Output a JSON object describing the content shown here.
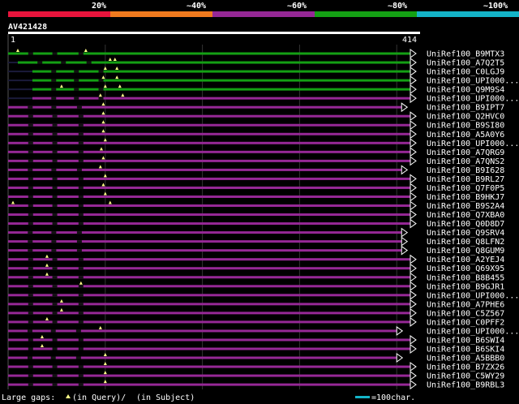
{
  "header": {
    "pct_labels": [
      "20%",
      "~40%",
      "~60%",
      "~80%",
      "~100%"
    ],
    "band_colors": [
      "#e8143c",
      "#f07a1e",
      "#962896",
      "#14a014",
      "#14b4c8"
    ]
  },
  "query": {
    "title": "AV421428",
    "start": "1",
    "end": "414",
    "length": 414
  },
  "colors": {
    "green": "#14a014",
    "purple": "#962896",
    "gap": "#222",
    "grid": "#333",
    "scale": "#14b4c8"
  },
  "hits": [
    {
      "name": "UniRef100_B9MTX3",
      "color": "green",
      "start": 0,
      "end": 414,
      "q_gaps": [
        10,
        80
      ]
    },
    {
      "name": "UniRef100_A7Q2T5",
      "color": "green",
      "start": 10,
      "end": 414,
      "q_gaps": [
        110,
        105
      ]
    },
    {
      "name": "UniRef100_C0LGJ9",
      "color": "green",
      "start": 25,
      "end": 414,
      "q_gaps": [
        100,
        112
      ]
    },
    {
      "name": "UniRef100_UPI000...",
      "color": "green",
      "start": 25,
      "end": 414,
      "q_gaps": [
        98,
        112
      ]
    },
    {
      "name": "UniRef100_Q9M9S4",
      "color": "green",
      "start": 25,
      "end": 414,
      "q_gaps": [
        55,
        100,
        115
      ]
    },
    {
      "name": "UniRef100_UPI000...",
      "color": "purple",
      "start": 25,
      "end": 414,
      "q_gaps": [
        95,
        118
      ]
    },
    {
      "name": "UniRef100_B9IPT7",
      "color": "purple",
      "start": 0,
      "end": 405,
      "q_gaps": [
        98
      ]
    },
    {
      "name": "UniRef100_Q2HVC0",
      "color": "purple",
      "start": 0,
      "end": 414,
      "q_gaps": [
        98
      ]
    },
    {
      "name": "UniRef100_B9SI80",
      "color": "purple",
      "start": 0,
      "end": 414,
      "q_gaps": [
        98
      ]
    },
    {
      "name": "UniRef100_A5A0Y6",
      "color": "purple",
      "start": 0,
      "end": 414,
      "q_gaps": [
        98
      ]
    },
    {
      "name": "UniRef100_UPI000...",
      "color": "purple",
      "start": 0,
      "end": 414,
      "q_gaps": [
        100
      ]
    },
    {
      "name": "UniRef100_A7QRG9",
      "color": "purple",
      "start": 0,
      "end": 414,
      "q_gaps": [
        96
      ]
    },
    {
      "name": "UniRef100_A7QNS2",
      "color": "purple",
      "start": 0,
      "end": 414,
      "q_gaps": [
        98
      ]
    },
    {
      "name": "UniRef100_B9I628",
      "color": "purple",
      "start": 0,
      "end": 405,
      "q_gaps": [
        95
      ]
    },
    {
      "name": "UniRef100_B9RL27",
      "color": "purple",
      "start": 0,
      "end": 414,
      "q_gaps": [
        100
      ]
    },
    {
      "name": "UniRef100_Q7F0P5",
      "color": "purple",
      "start": 0,
      "end": 414,
      "q_gaps": [
        98
      ]
    },
    {
      "name": "UniRef100_B9HKJ7",
      "color": "purple",
      "start": 0,
      "end": 414,
      "q_gaps": [
        100
      ]
    },
    {
      "name": "UniRef100_B9S2A4",
      "color": "purple",
      "start": 0,
      "end": 414,
      "q_gaps": [
        5,
        105
      ]
    },
    {
      "name": "UniRef100_Q7XBA0",
      "color": "purple",
      "start": 0,
      "end": 414,
      "q_gaps": []
    },
    {
      "name": "UniRef100_Q0D8D7",
      "color": "purple",
      "start": 0,
      "end": 414,
      "q_gaps": []
    },
    {
      "name": "UniRef100_Q9SRV4",
      "color": "purple",
      "start": 0,
      "end": 405,
      "q_gaps": []
    },
    {
      "name": "UniRef100_Q8LFN2",
      "color": "purple",
      "start": 0,
      "end": 405,
      "q_gaps": []
    },
    {
      "name": "UniRef100_Q8GUM9",
      "color": "purple",
      "start": 0,
      "end": 405,
      "q_gaps": []
    },
    {
      "name": "UniRef100_A2YEJ4",
      "color": "purple",
      "start": 0,
      "end": 414,
      "q_gaps": [
        40
      ]
    },
    {
      "name": "UniRef100_Q69X95",
      "color": "purple",
      "start": 0,
      "end": 414,
      "q_gaps": [
        40
      ]
    },
    {
      "name": "UniRef100_B8B455",
      "color": "purple",
      "start": 0,
      "end": 414,
      "q_gaps": [
        40
      ]
    },
    {
      "name": "UniRef100_B9GJR1",
      "color": "purple",
      "start": 0,
      "end": 414,
      "q_gaps": [
        75
      ]
    },
    {
      "name": "UniRef100_UPI000...",
      "color": "purple",
      "start": 0,
      "end": 414,
      "q_gaps": []
    },
    {
      "name": "UniRef100_A7PHE6",
      "color": "purple",
      "start": 0,
      "end": 414,
      "q_gaps": [
        55
      ]
    },
    {
      "name": "UniRef100_C5Z567",
      "color": "purple",
      "start": 0,
      "end": 414,
      "q_gaps": [
        55
      ]
    },
    {
      "name": "UniRef100_C0PFF2",
      "color": "purple",
      "start": 0,
      "end": 414,
      "q_gaps": [
        40
      ]
    },
    {
      "name": "UniRef100_UPI000...",
      "color": "purple",
      "start": 0,
      "end": 400,
      "q_gaps": [
        95
      ]
    },
    {
      "name": "UniRef100_B6SWI4",
      "color": "purple",
      "start": 0,
      "end": 414,
      "q_gaps": [
        35
      ]
    },
    {
      "name": "UniRef100_B6SKI4",
      "color": "purple",
      "start": 0,
      "end": 414,
      "q_gaps": [
        35
      ]
    },
    {
      "name": "UniRef100_A5BBB0",
      "color": "purple",
      "start": 0,
      "end": 400,
      "q_gaps": [
        100
      ]
    },
    {
      "name": "UniRef100_B7ZX26",
      "color": "purple",
      "start": 0,
      "end": 414,
      "q_gaps": [
        100
      ]
    },
    {
      "name": "UniRef100_C5WY29",
      "color": "purple",
      "start": 0,
      "end": 414,
      "q_gaps": [
        100
      ]
    },
    {
      "name": "UniRef100_B9RBL3",
      "color": "purple",
      "start": 0,
      "end": 414,
      "q_gaps": [
        100
      ]
    }
  ],
  "footer": {
    "legend_prefix": "Large gaps:",
    "legend_query": "(in Query)/",
    "legend_subject": "(in Subject)",
    "scale_label": "=100char."
  }
}
